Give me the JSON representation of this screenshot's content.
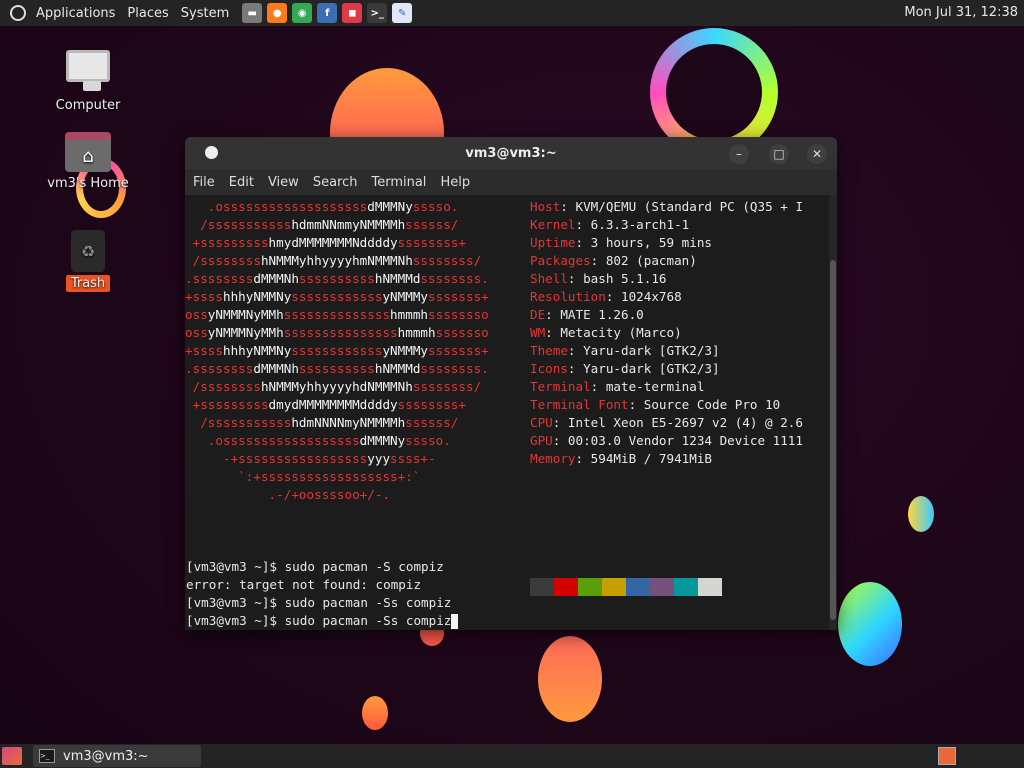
{
  "top_panel": {
    "menus": [
      "Applications",
      "Places",
      "System"
    ],
    "launchers": [
      {
        "name": "files-icon",
        "color": "#7a7a7a",
        "glyph": "▬"
      },
      {
        "name": "firefox-icon",
        "color": "#ff7a1a",
        "glyph": "●"
      },
      {
        "name": "chrome-icon",
        "color": "#34a853",
        "glyph": "◉"
      },
      {
        "name": "fedora-icon",
        "color": "#3c6eb4",
        "glyph": "f"
      },
      {
        "name": "screenshot-icon",
        "color": "#e03a4a",
        "glyph": "◼"
      },
      {
        "name": "terminal-icon",
        "color": "#3a3a3a",
        "glyph": ">_"
      },
      {
        "name": "text-editor-icon",
        "color": "#e0e8f8",
        "glyph": "✎"
      }
    ],
    "clock": "Mon Jul 31, 12:38"
  },
  "desktop": {
    "icons": [
      {
        "label": "Computer"
      },
      {
        "label": "vm3's Home"
      },
      {
        "label": "Trash"
      }
    ]
  },
  "terminal": {
    "title": "vm3@vm3:~",
    "menu": [
      "File",
      "Edit",
      "View",
      "Search",
      "Terminal",
      "Help"
    ],
    "ascii_art": [
      "   .osssssssssssssssssssdMMMNysssso.",
      "  /ssssssssssshdmmNNmmyNMMMMhssssss/",
      " +ssssssssshmydMMMMMMMNddddyssssssss+",
      " /sssssssshNMMMyhhyyyyhmNMMMNhssssssss/",
      ".ssssssssdMMMNhsssssssssshNMMMdssssssss.",
      "+sssshhhyNMMNyssssssssssssyNMMMysssssss+",
      "ossyNMMMNyMMhsssssssssssssshmmmhssssssso",
      "ossyNMMMNyMMhssssssssssssssshmmmhsssssso",
      "+sssshhhyNMMNyssssssssssssyNMMMysssssss+",
      ".ssssssssdMMMNhsssssssssshNMMMdssssssss.",
      " /sssssssshNMMMyhhyyyyhdNMMMNhssssssss/",
      " +sssssssssdmydMMMMMMMMddddyssssssss+",
      "  /ssssssssssshdmNNNNmyNMMMMhssssss/",
      "   .ossssssssssssssssssdMMMNysssso.",
      "     -+sssssssssssssssssyyyssss+-",
      "       `:+ssssssssssssssssss+:`",
      "           .-/+oossssoo+/-."
    ],
    "sysinfo": [
      {
        "key": "Host",
        "value": "KVM/QEMU (Standard PC (Q35 + I"
      },
      {
        "key": "Kernel",
        "value": "6.3.3-arch1-1"
      },
      {
        "key": "Uptime",
        "value": "3 hours, 59 mins"
      },
      {
        "key": "Packages",
        "value": "802 (pacman)"
      },
      {
        "key": "Shell",
        "value": "bash 5.1.16"
      },
      {
        "key": "Resolution",
        "value": "1024x768"
      },
      {
        "key": "DE",
        "value": "MATE 1.26.0"
      },
      {
        "key": "WM",
        "value": "Metacity (Marco)"
      },
      {
        "key": "Theme",
        "value": "Yaru-dark [GTK2/3]"
      },
      {
        "key": "Icons",
        "value": "Yaru-dark [GTK2/3]"
      },
      {
        "key": "Terminal",
        "value": "mate-terminal"
      },
      {
        "key": "Terminal Font",
        "value": "Source Code Pro 10"
      },
      {
        "key": "CPU",
        "value": "Intel Xeon E5-2697 v2 (4) @ 2.6"
      },
      {
        "key": "GPU",
        "value": "00:03.0 Vendor 1234 Device 1111"
      },
      {
        "key": "Memory",
        "value": "594MiB / 7941MiB"
      }
    ],
    "palette_dark": [
      "#3a3a3a",
      "#d40000",
      "#5a9e0a",
      "#c4a000",
      "#3465a4",
      "#75507b",
      "#06989a",
      "#d3d7cf"
    ],
    "palette_light": [
      "#555753",
      "#ef2929",
      "#8ae234",
      "#fce94f",
      "#729fcf",
      "#ad7fa8",
      "#34e2e2",
      "#eeeeec"
    ],
    "shell_lines": [
      "[vm3@vm3 ~]$ sudo pacman -S compiz",
      "error: target not found: compiz",
      "[vm3@vm3 ~]$ sudo pacman -Ss compiz",
      "[vm3@vm3 ~]$ sudo pacman -Ss compiz"
    ]
  },
  "bottom_panel": {
    "task_label": "vm3@vm3:~"
  }
}
